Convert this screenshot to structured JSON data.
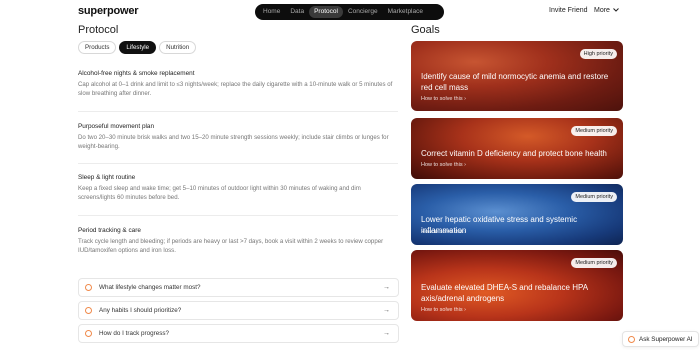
{
  "brand": {
    "logo": "superpower"
  },
  "nav": {
    "items": [
      {
        "label": "Home",
        "active": false
      },
      {
        "label": "Data",
        "active": false
      },
      {
        "label": "Protocol",
        "active": true
      },
      {
        "label": "Concierge",
        "active": false
      },
      {
        "label": "Marketplace",
        "active": false
      }
    ]
  },
  "header_right": {
    "invite": "Invite Friend",
    "more": "More",
    "more_icon": "chevron-down-icon"
  },
  "protocol": {
    "heading": "Protocol",
    "tabs": [
      {
        "label": "Products",
        "active": false
      },
      {
        "label": "Lifestyle",
        "active": true
      },
      {
        "label": "Nutrition",
        "active": false
      }
    ],
    "items": [
      {
        "title": "Alcohol-free nights & smoke replacement",
        "desc": "Cap alcohol at 0–1 drink and limit to ≤3 nights/week; replace the daily cigarette with a 10-minute walk or 5 minutes of slow breathing after dinner."
      },
      {
        "title": "Purposeful movement plan",
        "desc": "Do two 20–30 minute brisk walks and two 15–20 minute strength sessions weekly; include stair climbs or lunges for weight-bearing."
      },
      {
        "title": "Sleep & light routine",
        "desc": "Keep a fixed sleep and wake time; get 5–10 minutes of outdoor light within 30 minutes of waking and dim screens/lights 60 minutes before bed."
      },
      {
        "title": "Period tracking & care",
        "desc": "Track cycle length and bleeding; if periods are heavy or last >7 days, book a visit within 2 weeks to review copper IUD/tamoxifen options and iron loss."
      }
    ],
    "faqs": [
      {
        "question": "What lifestyle changes matter most?"
      },
      {
        "question": "Any habits I should prioritize?"
      },
      {
        "question": "How do I track progress?"
      }
    ]
  },
  "goals": {
    "heading": "Goals",
    "cards": [
      {
        "priority": "High priority",
        "title": "Identify cause of mild normocytic anemia and restore red cell mass",
        "link": "How to solve this",
        "link_icon": "chevron-right-icon",
        "color": "#8a2616"
      },
      {
        "priority": "Medium priority",
        "title": "Correct vitamin D deficiency and protect bone health",
        "link": "How to solve this",
        "link_icon": "chevron-right-icon",
        "color": "#8c2a15"
      },
      {
        "priority": "Medium priority",
        "title": "Lower hepatic oxidative stress and systemic inflammation",
        "link": "How to solve this",
        "link_icon": "chevron-right-icon",
        "color": "#234f92"
      },
      {
        "priority": "Medium priority",
        "title": "Evaluate elevated DHEA-S and rebalance HPA axis/adrenal androgens",
        "link": "How to solve this",
        "link_icon": "chevron-right-icon",
        "color": "#9a2a16"
      }
    ]
  },
  "assistant": {
    "label": "Ask Superpower AI"
  }
}
